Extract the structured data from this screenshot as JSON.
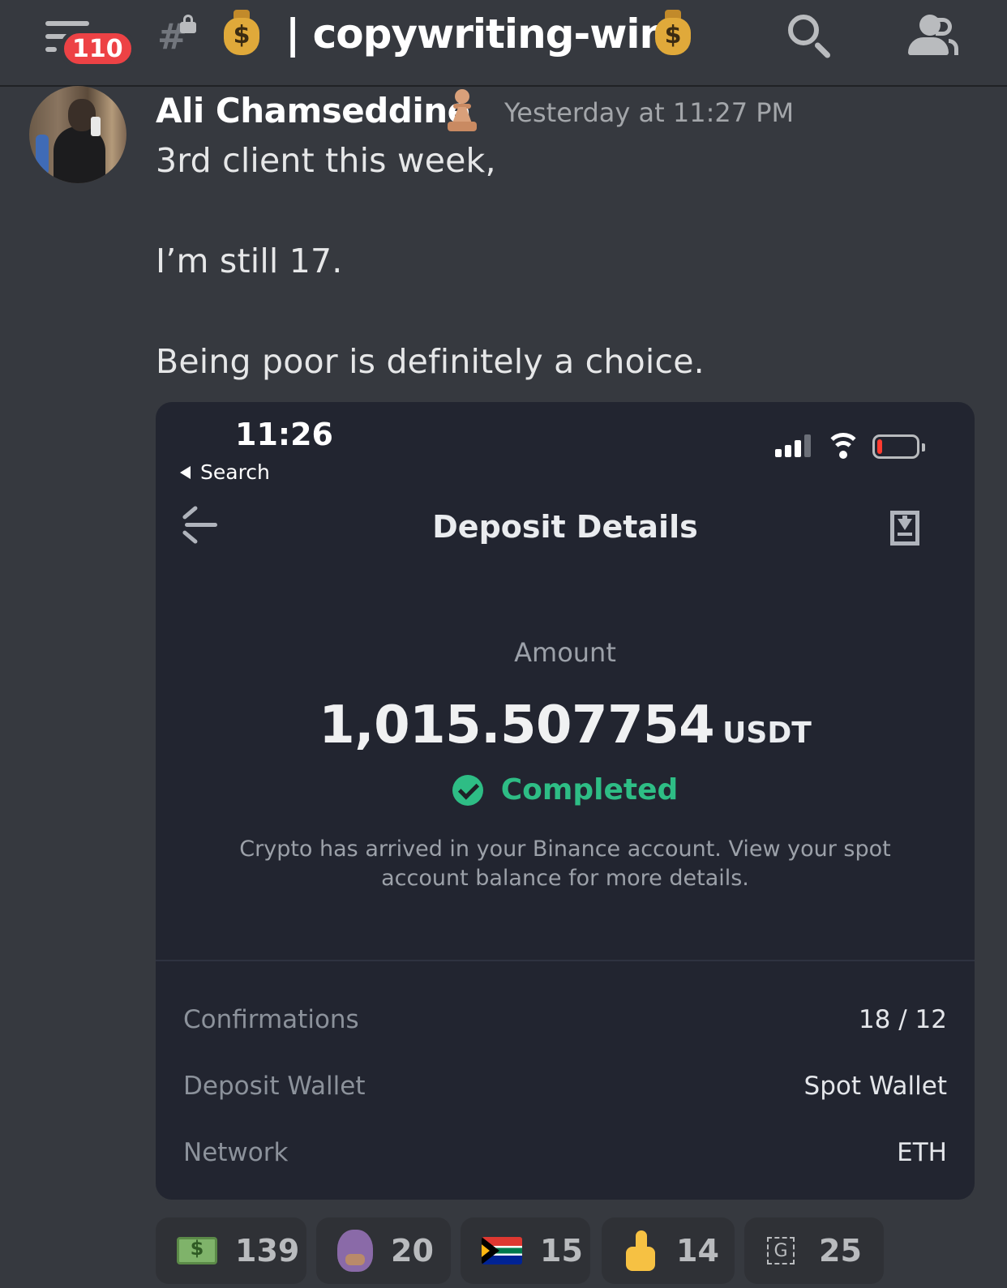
{
  "header": {
    "notification_count": "110",
    "channel_name": "| copywriting-wins"
  },
  "message": {
    "author": "Ali Chamseddine",
    "timestamp": "Yesterday at 11:27 PM",
    "lines": [
      "3rd client this week,",
      "I’m still 17.",
      "Being poor is definitely a choice."
    ]
  },
  "attachment": {
    "status_time": "11:26",
    "back_app": "Search",
    "title": "Deposit Details",
    "amount_label": "Amount",
    "amount_value": "1,015.507754",
    "amount_unit": "USDT",
    "status": "Completed",
    "info": "Crypto has arrived in your Binance account. View your spot account balance for more details.",
    "details": [
      {
        "label": "Confirmations",
        "value": "18 / 12"
      },
      {
        "label": "Deposit Wallet",
        "value": "Spot Wallet"
      },
      {
        "label": "Network",
        "value": "ETH"
      }
    ]
  },
  "reactions": [
    {
      "emoji": "money-with-wings",
      "count": "139"
    },
    {
      "emoji": "face",
      "count": "20"
    },
    {
      "emoji": "south-africa-flag",
      "count": "15"
    },
    {
      "emoji": "thumbs-up",
      "count": "14"
    },
    {
      "emoji": "g-sticker",
      "count": "25"
    }
  ],
  "colors": {
    "background": "#36393f",
    "attachment_bg": "#222530",
    "completed_green": "#2ebd85",
    "badge_red": "#ed4245"
  }
}
